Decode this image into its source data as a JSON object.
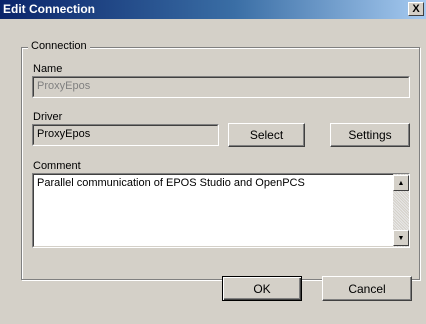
{
  "window": {
    "title": "Edit Connection",
    "close_glyph": "X"
  },
  "group": {
    "legend": "Connection",
    "name_label": "Name",
    "name_value": "ProxyEpos",
    "driver_label": "Driver",
    "driver_value": "ProxyEpos",
    "select_label": "Select",
    "settings_label": "Settings",
    "comment_label": "Comment",
    "comment_value": "Parallel communication of EPOS Studio and OpenPCS"
  },
  "buttons": {
    "ok_label": "OK",
    "cancel_label": "Cancel"
  },
  "icons": {
    "scroll_up": "scroll-up-arrow-icon",
    "scroll_down": "scroll-down-arrow-icon",
    "close": "close-icon"
  }
}
